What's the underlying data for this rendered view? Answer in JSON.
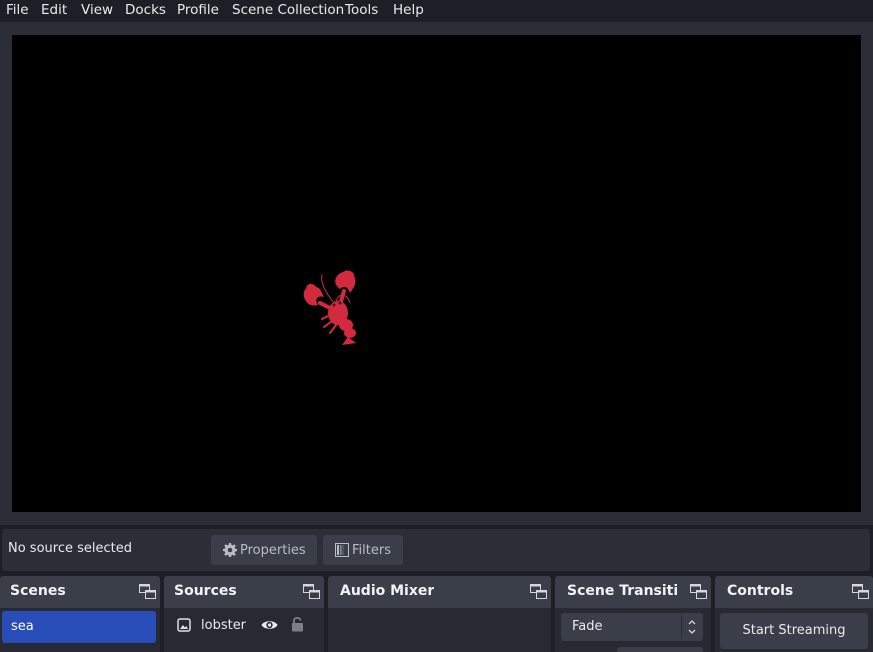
{
  "menu": {
    "file": "File",
    "edit": "Edit",
    "view": "View",
    "docks": "Docks",
    "profile": "Profile",
    "scene_collection": "Scene Collection",
    "tools": "Tools",
    "help": "Help"
  },
  "source_toolbar": {
    "status": "No source selected",
    "properties": "Properties",
    "filters": "Filters"
  },
  "docks": {
    "scenes": {
      "title": "Scenes",
      "items": [
        {
          "label": "sea",
          "selected": true
        }
      ]
    },
    "sources": {
      "title": "Sources",
      "items": [
        {
          "label": "lobster",
          "icon": "image-icon",
          "visible": true,
          "locked": false
        }
      ]
    },
    "audio_mixer": {
      "title": "Audio Mixer"
    },
    "scene_transitions": {
      "title": "Scene Transiti...",
      "selected": "Fade"
    },
    "controls": {
      "title": "Controls",
      "start_streaming": "Start Streaming"
    }
  },
  "colors": {
    "background": "#1d1f26",
    "panel": "#2b2e37",
    "dock_header": "#3a3e49",
    "selection": "#284cb8",
    "preview": "#000000",
    "lobster": "#d32a3f"
  }
}
